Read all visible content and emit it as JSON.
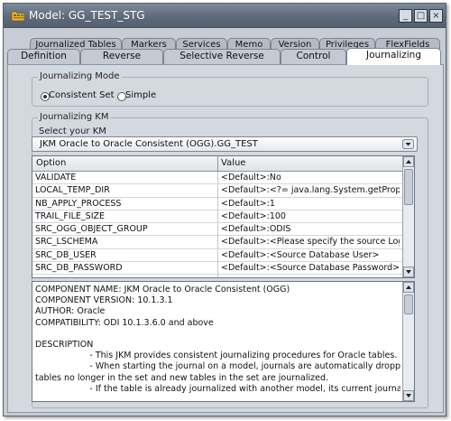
{
  "window": {
    "title": "Model: GG_TEST_STG",
    "icon": "folder-model-icon",
    "controls": [
      "minimize-icon",
      "maximize-icon",
      "close-icon"
    ]
  },
  "tabs": {
    "back_row": [
      "Journalized Tables",
      "Markers",
      "Services",
      "Memo",
      "Version",
      "Privileges",
      "FlexFields"
    ],
    "front_row": [
      "Definition",
      "Reverse",
      "Selective Reverse",
      "Control",
      "Journalizing"
    ],
    "active": "Journalizing"
  },
  "journalizing_mode": {
    "title": "Journalizing Mode",
    "options": [
      "Consistent Set",
      "Simple"
    ],
    "selected": "Consistent Set"
  },
  "journalizing_km": {
    "title": "Journalizing KM",
    "select_label": "Select your KM",
    "selected_km": "JKM Oracle to Oracle Consistent (OGG).GG_TEST"
  },
  "options_table": {
    "headers": [
      "Option",
      "Value"
    ],
    "rows": [
      {
        "option": "VALIDATE",
        "value": "<Default>:No"
      },
      {
        "option": "LOCAL_TEMP_DIR",
        "value": "<Default>:<?= java.lang.System.getProperty(\"..."
      },
      {
        "option": "NB_APPLY_PROCESS",
        "value": "<Default>:1"
      },
      {
        "option": "TRAIL_FILE_SIZE",
        "value": "<Default>:100"
      },
      {
        "option": "SRC_OGG_OBJECT_GROUP",
        "value": "<Default>:ODIS"
      },
      {
        "option": "SRC_LSCHEMA",
        "value": "<Default>:<Please specify the source Logical ..."
      },
      {
        "option": "SRC_DB_USER",
        "value": "<Default>:<Source Database User>"
      },
      {
        "option": "SRC_DB_PASSWORD",
        "value": "<Default>:<Source Database Password>"
      }
    ]
  },
  "description": {
    "lines": [
      "COMPONENT NAME: JKM Oracle to Oracle Consistent (OGG)",
      "COMPONENT VERSION: 10.1.3.1",
      "AUTHOR: Oracle",
      "COMPATIBILITY: ODI 10.1.3.6.0 and above",
      "",
      "DESCRIPTION",
      "                    - This JKM provides consistent journalizing procedures for Oracle tables.",
      "                    - When starting the journal on a model, journals are automatically dropped from",
      "tables no longer in the set and new tables in the set are journalized.",
      "                    - If the table is already journalized with another model, its current journal data is lost"
    ]
  }
}
